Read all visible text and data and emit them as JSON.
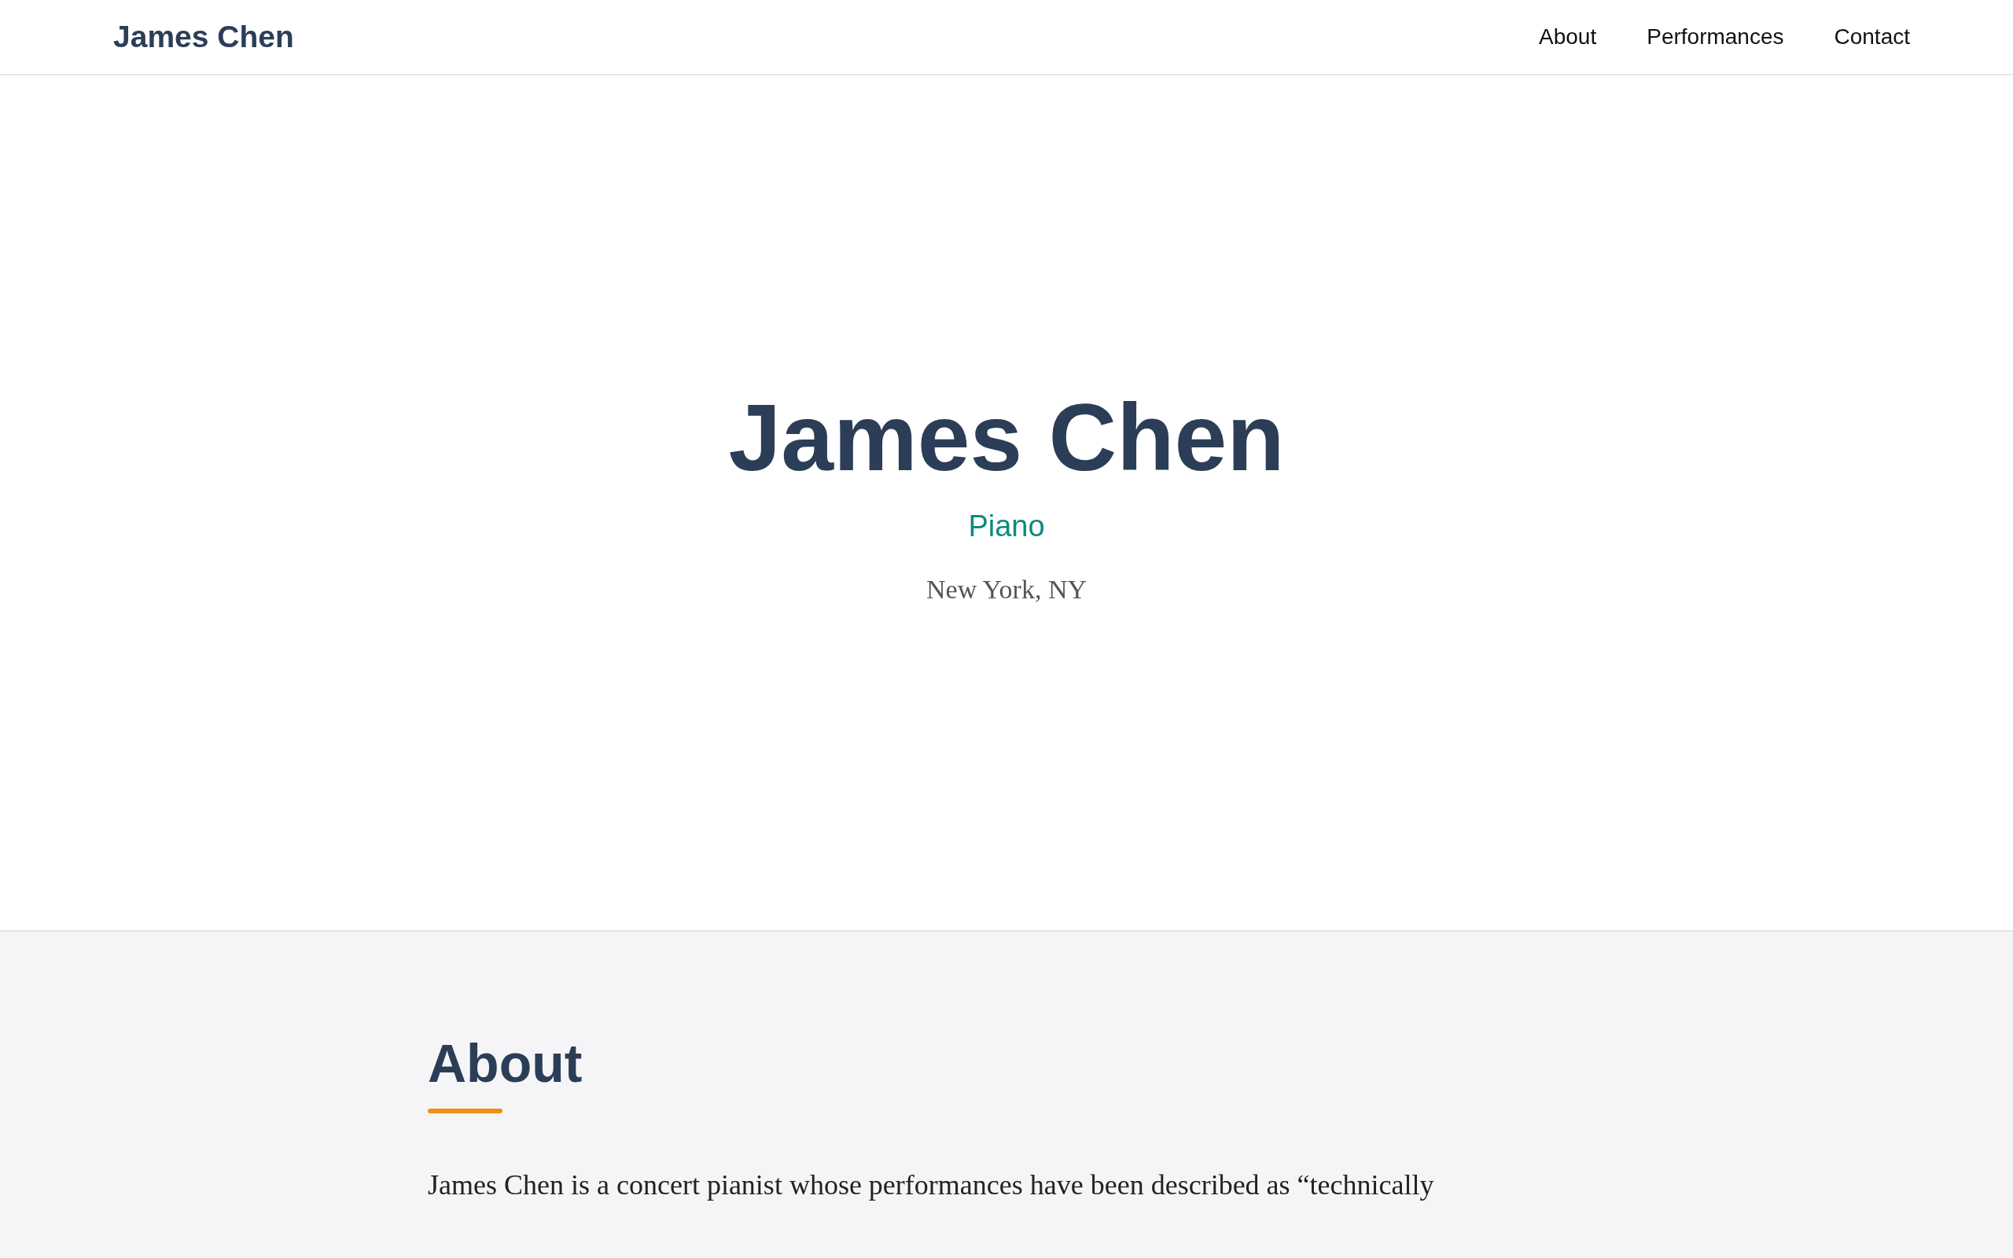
{
  "header": {
    "brand": "James Chen",
    "nav": [
      {
        "label": "About"
      },
      {
        "label": "Performances"
      },
      {
        "label": "Contact"
      }
    ]
  },
  "hero": {
    "name": "James Chen",
    "instrument": "Piano",
    "location": "New York, NY"
  },
  "about": {
    "heading": "About",
    "paragraph": "James Chen is a concert pianist whose performances have been described as “technically"
  }
}
